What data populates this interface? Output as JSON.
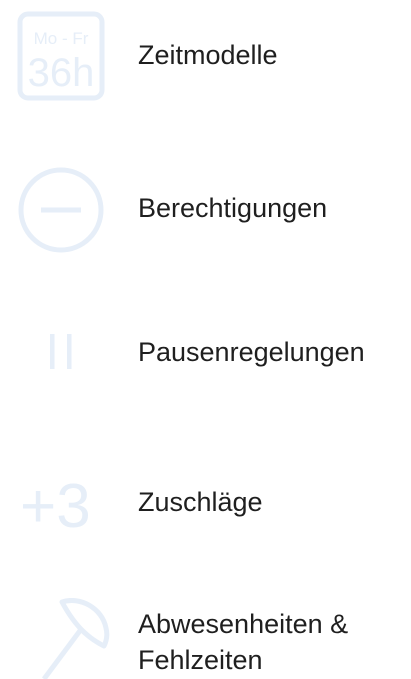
{
  "accent_color": "#e6eef8",
  "items": [
    {
      "label": "Zeitmodelle",
      "icon": "weekly-hours-icon",
      "icon_text_top": "Mo - Fr",
      "icon_text_main": "36h"
    },
    {
      "label": "Berechtigungen",
      "icon": "minus-circle-icon"
    },
    {
      "label": "Pausenregelungen",
      "icon": "pause-icon"
    },
    {
      "label": "Zuschläge",
      "icon": "plus-three-icon",
      "icon_text_main": "+3"
    },
    {
      "label": "Abwesenheiten &\nFehlzeiten",
      "label_line1": "Abwesenheiten &",
      "label_line2": "Fehlzeiten",
      "icon": "parasol-icon"
    }
  ]
}
